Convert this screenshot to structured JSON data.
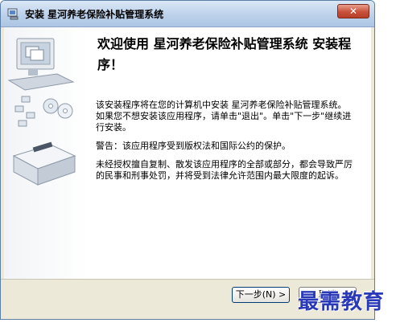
{
  "window": {
    "title": "安装 星河养老保险补贴管理系统",
    "close_glyph": "✕"
  },
  "main": {
    "heading": "欢迎使用 星河养老保险补贴管理系统 安装程序！",
    "para1": "该安装程序将在您的计算机中安装 星河养老保险补贴管理系统。如果您不想安装该应用程序，请单击\"退出\"。单击\"下一步\"继续进行安装。",
    "para2": "警告：该应用程序受到版权法和国际公约的保护。",
    "para3": "未经授权擅自复制、散发该应用程序的全部或部分，都会导致严厉的民事和刑事处罚，并将受到法律允许范围内最大限度的起诉。"
  },
  "buttons": {
    "next": "下一步(N) >",
    "cancel": "取消"
  },
  "watermark": "最需教育",
  "icons": {
    "app": "installer-icon",
    "side": "computer-disks-illustration"
  }
}
